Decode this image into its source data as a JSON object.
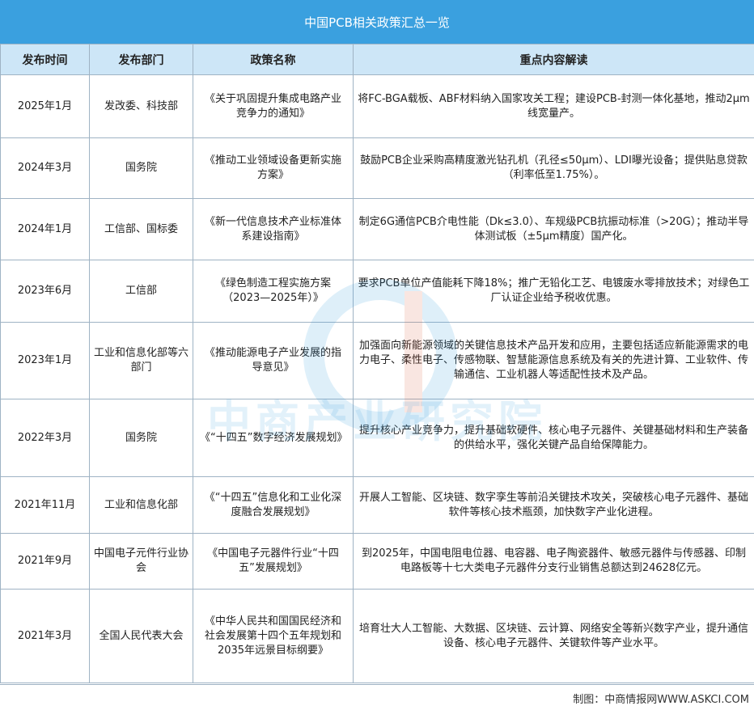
{
  "title": "中国PCB相关政策汇总一览",
  "headers": [
    "发布时间",
    "发布部门",
    "政策名称",
    "重点内容解读"
  ],
  "rows": [
    {
      "date": "2025年1月",
      "dept": "发改委、科技部",
      "policy": "《关于巩固提升集成电路产业竞争力的通知》",
      "content": "将FC-BGA载板、ABF材料纳入国家攻关工程；建设PCB-封测一体化基地，推动2μm线宽量产。"
    },
    {
      "date": "2024年3月",
      "dept": "国务院",
      "policy": "《推动工业领域设备更新实施方案》",
      "content": "鼓励PCB企业采购高精度激光钻孔机（孔径≤50μm）、LDI曝光设备；提供贴息贷款（利率低至1.75%）。"
    },
    {
      "date": "2024年1月",
      "dept": "工信部、国标委",
      "policy": "《新一代信息技术产业标准体系建设指南》",
      "content": "制定6G通信PCB介电性能（Dk≤3.0）、车规级PCB抗振动标准（>20G）；推动半导体测试板（±5μm精度）国产化。"
    },
    {
      "date": "2023年6月",
      "dept": "工信部",
      "policy": "《绿色制造工程实施方案（2023—2025年）》",
      "content": "要求PCB单位产值能耗下降18%；推广无铅化工艺、电镀废水零排放技术；对绿色工厂认证企业给予税收优惠。"
    },
    {
      "date": "2023年1月",
      "dept": "工业和信息化部等六部门",
      "policy": "《推动能源电子产业发展的指导意见》",
      "content": "加强面向新能源领域的关键信息技术产品开发和应用，主要包括适应新能源需求的电力电子、柔性电子、传感物联、智慧能源信息系统及有关的先进计算、工业软件、传输通信、工业机器人等适配性技术及产品。"
    },
    {
      "date": "2022年3月",
      "dept": "国务院",
      "policy": "《“十四五”数字经济发展规划》",
      "content": "提升核心产业竞争力，提升基础软硬件、核心电子元器件、关键基础材料和生产装备的供给水平，强化关键产品自给保障能力。"
    },
    {
      "date": "2021年11月",
      "dept": "工业和信息化部",
      "policy": "《“十四五”信息化和工业化深度融合发展规划》",
      "content": "开展人工智能、区块链、数字孪生等前沿关键技术攻关，突破核心电子元器件、基础软件等核心技术瓶颈，加快数字产业化进程。"
    },
    {
      "date": "2021年9月",
      "dept": "中国电子元件行业协会",
      "policy": "《中国电子元器件行业“十四五”发展规划》",
      "content": "到2025年，中国电阻电位器、电容器、电子陶瓷器件、敏感元器件与传感器、印制电路板等十七大类电子元器件分支行业销售总额达到24628亿元。"
    },
    {
      "date": "2021年3月",
      "dept": "全国人民代表大会",
      "policy": "《中华人民共和国国民经济和社会发展第十四个五年规划和2035年远景目标纲要》",
      "content": "培育壮大人工智能、大数据、区块链、云计算、网络安全等新兴数字产业，提升通信设备、核心电子元器件、关键软件等产业水平。"
    }
  ],
  "watermark": "中商产业研究院",
  "footer": "制图：中商情报网WWW.ASKCI.COM",
  "colors": {
    "title_bg": "#3AA0DF",
    "header_bg": "#CDE6F7",
    "border": "#9fb3c4"
  }
}
